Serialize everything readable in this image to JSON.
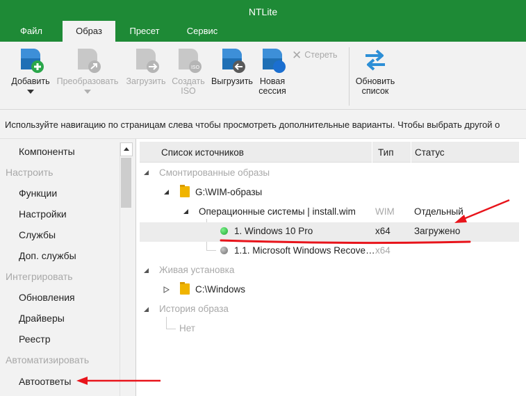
{
  "window": {
    "title": "NTLite"
  },
  "menu": {
    "tabs": [
      "Файл",
      "Образ",
      "Пресет",
      "Сервис"
    ],
    "active": "Образ"
  },
  "ribbon": {
    "add": {
      "label": "Добавить",
      "icon": "add-image-icon"
    },
    "convert": {
      "label": "Преобразовать",
      "icon": "convert-icon"
    },
    "load": {
      "label": "Загрузить",
      "icon": "load-icon"
    },
    "create_iso_line1": "Создать",
    "create_iso_line2": "ISO",
    "unload": {
      "label": "Выгрузить",
      "icon": "unload-icon"
    },
    "new_session_line1": "Новая",
    "new_session_line2": "сессия",
    "erase": {
      "label": "Стереть",
      "icon": "close-icon"
    },
    "refresh_line1": "Обновить",
    "refresh_line2": "список"
  },
  "hint": "Используйте навигацию по страницам слева чтобы просмотреть дополнительные варианты. Чтобы выбрать другой о",
  "sidebar": {
    "items": [
      {
        "label": "Компоненты",
        "type": "item"
      },
      {
        "label": "Настроить",
        "type": "group"
      },
      {
        "label": "Функции",
        "type": "item"
      },
      {
        "label": "Настройки",
        "type": "item"
      },
      {
        "label": "Службы",
        "type": "item"
      },
      {
        "label": "Доп. службы",
        "type": "item"
      },
      {
        "label": "Интегрировать",
        "type": "group"
      },
      {
        "label": "Обновления",
        "type": "item"
      },
      {
        "label": "Драйверы",
        "type": "item"
      },
      {
        "label": "Реестр",
        "type": "item"
      },
      {
        "label": "Автоматизировать",
        "type": "group"
      },
      {
        "label": "Автоответы",
        "type": "item"
      }
    ]
  },
  "table": {
    "columns": {
      "source": "Список источников",
      "type": "Тип",
      "status": "Статус"
    },
    "mounted_group": "Смонтированные образы",
    "wim_folder": "G:\\WIM-образы",
    "install_wim": {
      "name": "Операционные системы  |  install.wim",
      "type": "WIM",
      "status": "Отдельный"
    },
    "edition1": {
      "name": "1. Windows 10 Pro",
      "type": "x64",
      "status": "Загружено"
    },
    "edition2": {
      "name": "1.1. Microsoft Windows Recove…",
      "type": "x64"
    },
    "live_group": "Живая установка",
    "live_folder": "C:\\Windows",
    "history_group": "История образа",
    "history_none": "Нет"
  },
  "colors": {
    "titlebar": "#1e8a36",
    "annotation": "#e8141b",
    "loaded_dot": "#27c13a",
    "unloaded_dot": "#8a8a8a"
  }
}
